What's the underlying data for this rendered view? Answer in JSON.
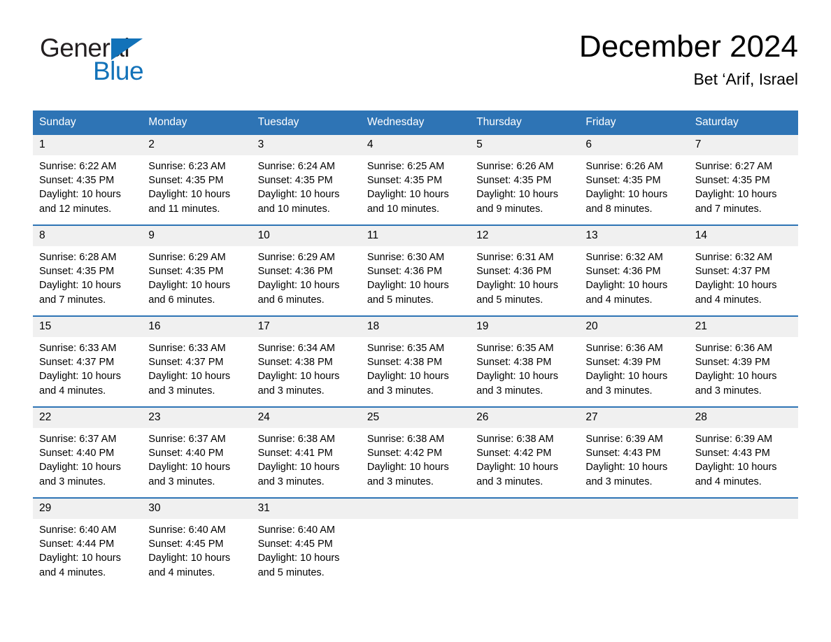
{
  "brand": {
    "name_part1": "General",
    "name_part2": "Blue",
    "triangle_color": "#1272b9",
    "text_color": "#231f20"
  },
  "header": {
    "title": "December 2024",
    "subtitle": "Bet ‘Arif, Israel"
  },
  "theme": {
    "header_blue": "#2e74b5",
    "daynum_band": "#f0f0f0",
    "text": "#000000"
  },
  "weekday_headers": [
    "Sunday",
    "Monday",
    "Tuesday",
    "Wednesday",
    "Thursday",
    "Friday",
    "Saturday"
  ],
  "weeks": [
    [
      {
        "day": "1",
        "sunrise": "Sunrise: 6:22 AM",
        "sunset": "Sunset: 4:35 PM",
        "daylight": "Daylight: 10 hours and 12 minutes."
      },
      {
        "day": "2",
        "sunrise": "Sunrise: 6:23 AM",
        "sunset": "Sunset: 4:35 PM",
        "daylight": "Daylight: 10 hours and 11 minutes."
      },
      {
        "day": "3",
        "sunrise": "Sunrise: 6:24 AM",
        "sunset": "Sunset: 4:35 PM",
        "daylight": "Daylight: 10 hours and 10 minutes."
      },
      {
        "day": "4",
        "sunrise": "Sunrise: 6:25 AM",
        "sunset": "Sunset: 4:35 PM",
        "daylight": "Daylight: 10 hours and 10 minutes."
      },
      {
        "day": "5",
        "sunrise": "Sunrise: 6:26 AM",
        "sunset": "Sunset: 4:35 PM",
        "daylight": "Daylight: 10 hours and 9 minutes."
      },
      {
        "day": "6",
        "sunrise": "Sunrise: 6:26 AM",
        "sunset": "Sunset: 4:35 PM",
        "daylight": "Daylight: 10 hours and 8 minutes."
      },
      {
        "day": "7",
        "sunrise": "Sunrise: 6:27 AM",
        "sunset": "Sunset: 4:35 PM",
        "daylight": "Daylight: 10 hours and 7 minutes."
      }
    ],
    [
      {
        "day": "8",
        "sunrise": "Sunrise: 6:28 AM",
        "sunset": "Sunset: 4:35 PM",
        "daylight": "Daylight: 10 hours and 7 minutes."
      },
      {
        "day": "9",
        "sunrise": "Sunrise: 6:29 AM",
        "sunset": "Sunset: 4:35 PM",
        "daylight": "Daylight: 10 hours and 6 minutes."
      },
      {
        "day": "10",
        "sunrise": "Sunrise: 6:29 AM",
        "sunset": "Sunset: 4:36 PM",
        "daylight": "Daylight: 10 hours and 6 minutes."
      },
      {
        "day": "11",
        "sunrise": "Sunrise: 6:30 AM",
        "sunset": "Sunset: 4:36 PM",
        "daylight": "Daylight: 10 hours and 5 minutes."
      },
      {
        "day": "12",
        "sunrise": "Sunrise: 6:31 AM",
        "sunset": "Sunset: 4:36 PM",
        "daylight": "Daylight: 10 hours and 5 minutes."
      },
      {
        "day": "13",
        "sunrise": "Sunrise: 6:32 AM",
        "sunset": "Sunset: 4:36 PM",
        "daylight": "Daylight: 10 hours and 4 minutes."
      },
      {
        "day": "14",
        "sunrise": "Sunrise: 6:32 AM",
        "sunset": "Sunset: 4:37 PM",
        "daylight": "Daylight: 10 hours and 4 minutes."
      }
    ],
    [
      {
        "day": "15",
        "sunrise": "Sunrise: 6:33 AM",
        "sunset": "Sunset: 4:37 PM",
        "daylight": "Daylight: 10 hours and 4 minutes."
      },
      {
        "day": "16",
        "sunrise": "Sunrise: 6:33 AM",
        "sunset": "Sunset: 4:37 PM",
        "daylight": "Daylight: 10 hours and 3 minutes."
      },
      {
        "day": "17",
        "sunrise": "Sunrise: 6:34 AM",
        "sunset": "Sunset: 4:38 PM",
        "daylight": "Daylight: 10 hours and 3 minutes."
      },
      {
        "day": "18",
        "sunrise": "Sunrise: 6:35 AM",
        "sunset": "Sunset: 4:38 PM",
        "daylight": "Daylight: 10 hours and 3 minutes."
      },
      {
        "day": "19",
        "sunrise": "Sunrise: 6:35 AM",
        "sunset": "Sunset: 4:38 PM",
        "daylight": "Daylight: 10 hours and 3 minutes."
      },
      {
        "day": "20",
        "sunrise": "Sunrise: 6:36 AM",
        "sunset": "Sunset: 4:39 PM",
        "daylight": "Daylight: 10 hours and 3 minutes."
      },
      {
        "day": "21",
        "sunrise": "Sunrise: 6:36 AM",
        "sunset": "Sunset: 4:39 PM",
        "daylight": "Daylight: 10 hours and 3 minutes."
      }
    ],
    [
      {
        "day": "22",
        "sunrise": "Sunrise: 6:37 AM",
        "sunset": "Sunset: 4:40 PM",
        "daylight": "Daylight: 10 hours and 3 minutes."
      },
      {
        "day": "23",
        "sunrise": "Sunrise: 6:37 AM",
        "sunset": "Sunset: 4:40 PM",
        "daylight": "Daylight: 10 hours and 3 minutes."
      },
      {
        "day": "24",
        "sunrise": "Sunrise: 6:38 AM",
        "sunset": "Sunset: 4:41 PM",
        "daylight": "Daylight: 10 hours and 3 minutes."
      },
      {
        "day": "25",
        "sunrise": "Sunrise: 6:38 AM",
        "sunset": "Sunset: 4:42 PM",
        "daylight": "Daylight: 10 hours and 3 minutes."
      },
      {
        "day": "26",
        "sunrise": "Sunrise: 6:38 AM",
        "sunset": "Sunset: 4:42 PM",
        "daylight": "Daylight: 10 hours and 3 minutes."
      },
      {
        "day": "27",
        "sunrise": "Sunrise: 6:39 AM",
        "sunset": "Sunset: 4:43 PM",
        "daylight": "Daylight: 10 hours and 3 minutes."
      },
      {
        "day": "28",
        "sunrise": "Sunrise: 6:39 AM",
        "sunset": "Sunset: 4:43 PM",
        "daylight": "Daylight: 10 hours and 4 minutes."
      }
    ],
    [
      {
        "day": "29",
        "sunrise": "Sunrise: 6:40 AM",
        "sunset": "Sunset: 4:44 PM",
        "daylight": "Daylight: 10 hours and 4 minutes."
      },
      {
        "day": "30",
        "sunrise": "Sunrise: 6:40 AM",
        "sunset": "Sunset: 4:45 PM",
        "daylight": "Daylight: 10 hours and 4 minutes."
      },
      {
        "day": "31",
        "sunrise": "Sunrise: 6:40 AM",
        "sunset": "Sunset: 4:45 PM",
        "daylight": "Daylight: 10 hours and 5 minutes."
      },
      {
        "day": "",
        "sunrise": "",
        "sunset": "",
        "daylight": ""
      },
      {
        "day": "",
        "sunrise": "",
        "sunset": "",
        "daylight": ""
      },
      {
        "day": "",
        "sunrise": "",
        "sunset": "",
        "daylight": ""
      },
      {
        "day": "",
        "sunrise": "",
        "sunset": "",
        "daylight": ""
      }
    ]
  ]
}
